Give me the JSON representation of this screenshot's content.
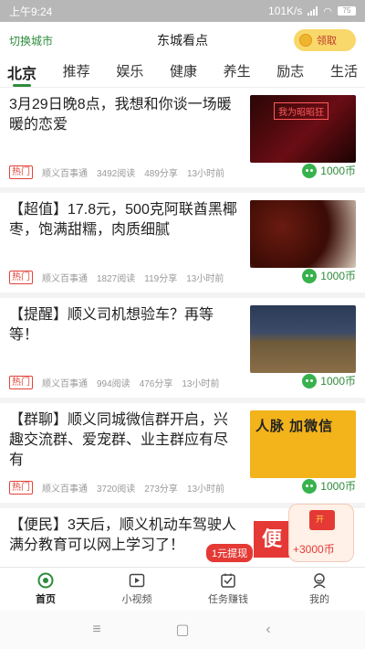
{
  "statusbar": {
    "time": "上午9:24",
    "speed": "101K/s",
    "battery": "75"
  },
  "header": {
    "city_switch": "切换城市",
    "title": "东城看点",
    "claim": "领取"
  },
  "tabs": [
    "北京",
    "推荐",
    "娱乐",
    "健康",
    "养生",
    "励志",
    "生活"
  ],
  "articles": [
    {
      "title": "3月29日晚8点，我想和你谈一场暖暖的恋爱",
      "badge": "热门",
      "source": "顺义百事通",
      "reads": "3492阅读",
      "shares": "489分享",
      "time": "13小时前",
      "reward": "1000币",
      "thumb_text": "我为昭昭狂"
    },
    {
      "title": "【超值】17.8元，500克阿联酋黑椰枣，饱满甜糯，肉质细腻",
      "badge": "热门",
      "source": "顺义百事通",
      "reads": "1827阅读",
      "shares": "119分享",
      "time": "13小时前",
      "reward": "1000币"
    },
    {
      "title": "【提醒】顺义司机想验车？再等等！",
      "badge": "热门",
      "source": "顺义百事通",
      "reads": "994阅读",
      "shares": "476分享",
      "time": "13小时前",
      "reward": "1000币"
    },
    {
      "title": "【群聊】顺义同城微信群开启，兴趣交流群、爱宠群、业主群应有尽有",
      "badge": "热门",
      "source": "顺义百事通",
      "reads": "3720阅读",
      "shares": "273分享",
      "time": "13小时前",
      "reward": "1000币",
      "thumb_text": "人脉 加微信"
    },
    {
      "title": "【便民】3天后，顺义机动车驾驶人满分教育可以网上学习了！",
      "thumb_text": "便"
    }
  ],
  "floating": {
    "envelope_label": "开",
    "amount": "+3000币",
    "withdraw": "1元提现"
  },
  "bottom_nav": [
    {
      "label": "首页",
      "icon": "home-icon"
    },
    {
      "label": "小视频",
      "icon": "video-icon"
    },
    {
      "label": "任务赚钱",
      "icon": "task-icon"
    },
    {
      "label": "我的",
      "icon": "profile-icon"
    }
  ],
  "system_nav": {
    "menu": "≡",
    "home": "▢",
    "back": "‹"
  }
}
